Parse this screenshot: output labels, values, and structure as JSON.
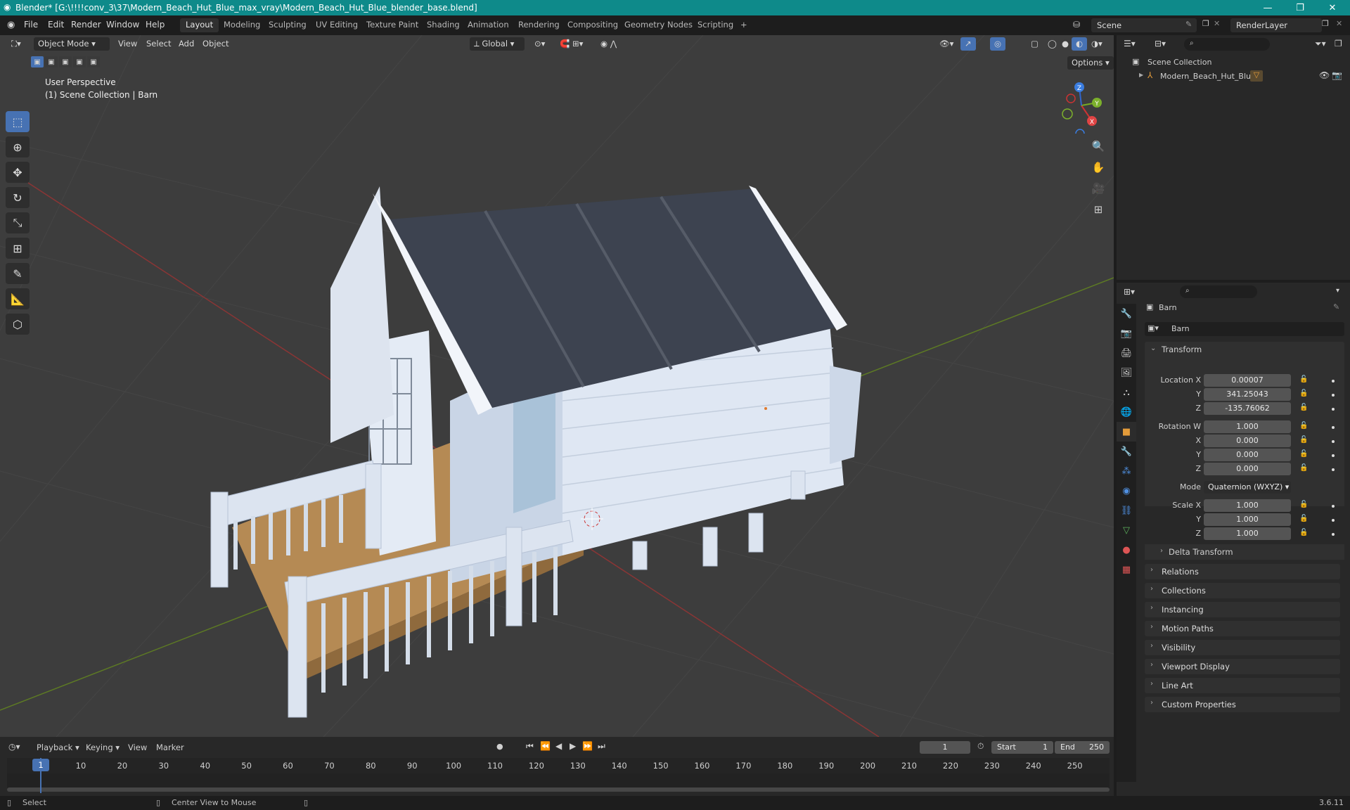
{
  "window": {
    "title": "Blender* [G:\\!!!!conv_3\\37\\Modern_Beach_Hut_Blue_max_vray\\Modern_Beach_Hut_Blue_blender_base.blend]",
    "min": "—",
    "max": "❐",
    "close": "✕"
  },
  "menu": {
    "items": [
      "File",
      "Edit",
      "Render",
      "Window",
      "Help"
    ]
  },
  "workspaces": [
    "Layout",
    "Modeling",
    "Sculpting",
    "UV Editing",
    "Texture Paint",
    "Shading",
    "Animation",
    "Rendering",
    "Compositing",
    "Geometry Nodes",
    "Scripting"
  ],
  "workspace_add": "+",
  "scene": {
    "label": "Scene",
    "render_layer": "RenderLayer"
  },
  "viewport": {
    "mode": "Object Mode",
    "menus": [
      "View",
      "Select",
      "Add",
      "Object"
    ],
    "orientation": "Global",
    "options": "Options",
    "info_line1": "User Perspective",
    "info_line2": "(1) Scene Collection | Barn",
    "axis": {
      "x": "X",
      "y": "Y",
      "z": "Z"
    },
    "colors": {
      "grid": "#3d3d3d",
      "x_axis": "#a83a3a",
      "y_axis": "#6a8a2c",
      "active_tool": "#4772b3"
    }
  },
  "outliner": {
    "root": "Scene Collection",
    "item": "Modern_Beach_Hut_Blue"
  },
  "properties": {
    "object_name": "Barn",
    "data_name": "Barn",
    "transform": {
      "title": "Transform",
      "location_label": "Location X",
      "location": {
        "x": "0.00007",
        "y": "341.25043",
        "z": "-135.76062"
      },
      "rotation_label": "Rotation W",
      "rotation": {
        "w": "1.000",
        "x": "0.000",
        "y": "0.000",
        "z": "0.000"
      },
      "mode_label": "Mode",
      "mode_value": "Quaternion (WXYZ)",
      "scale_label": "Scale X",
      "scale": {
        "x": "1.000",
        "y": "1.000",
        "z": "1.000"
      },
      "axis_y": "Y",
      "axis_z": "Z",
      "axis_x": "X"
    },
    "delta": "Delta Transform",
    "panels": [
      "Relations",
      "Collections",
      "Instancing",
      "Motion Paths",
      "Visibility",
      "Viewport Display",
      "Line Art",
      "Custom Properties"
    ]
  },
  "timeline": {
    "menus": [
      "Playback",
      "Keying",
      "View",
      "Marker"
    ],
    "current_frame": "1",
    "start_label": "Start",
    "start": "1",
    "end_label": "End",
    "end": "250",
    "ticks": [
      "1",
      "10",
      "20",
      "30",
      "40",
      "50",
      "60",
      "70",
      "80",
      "90",
      "100",
      "110",
      "120",
      "130",
      "140",
      "150",
      "160",
      "170",
      "180",
      "190",
      "200",
      "210",
      "220",
      "230",
      "240",
      "250"
    ]
  },
  "status": {
    "select": "Select",
    "center": "Center View to Mouse",
    "version": "3.6.11"
  }
}
